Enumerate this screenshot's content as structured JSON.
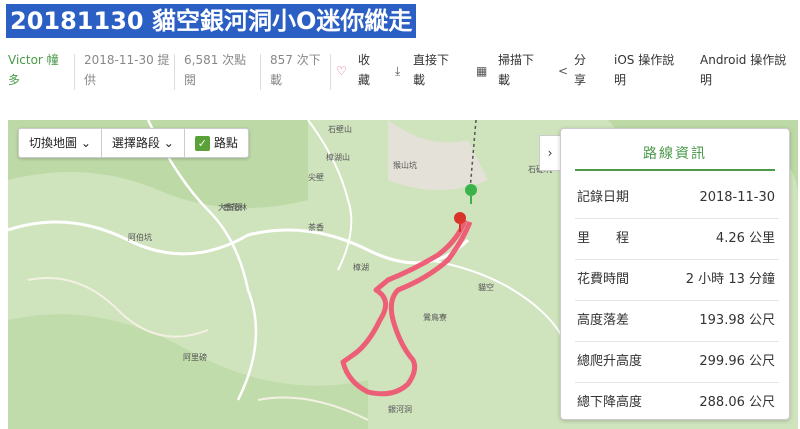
{
  "title": "20181130 貓空銀河洞小O迷你縱走",
  "meta": {
    "author_line1": "Victor 幢",
    "author_line2": "多",
    "date_line1": "2018-11-30 提",
    "date_line2": "供",
    "views_line1": "6,581 次點",
    "views_line2": "閱",
    "downloads_line1": "857 次下",
    "downloads_line2": "載",
    "fav_line1": "收",
    "fav_line2": "藏",
    "direct_line1": "直接下",
    "direct_line2": "載",
    "scan_line1": "掃描下",
    "scan_line2": "載",
    "share_line1": "分",
    "share_line2": "享",
    "ios_line1": "iOS 操作說",
    "ios_line2": "明",
    "android_line1": "Android 操作說",
    "android_line2": "明"
  },
  "toolbar": {
    "switch_map": "切換地圖",
    "select_route": "選擇路段",
    "waypoints": "路點"
  },
  "map_labels": [
    "石壁山",
    "樟湖山",
    "猴山坑",
    "尖壁",
    "大崙頭",
    "阿伯坑",
    "香花林",
    "茶香",
    "樟湖",
    "貓空",
    "鶯鳥寮",
    "阿里磅",
    "銀河洞",
    "石碇坑"
  ],
  "panel": {
    "title": "路線資訊",
    "rows": [
      {
        "label": "記錄日期",
        "value": "2018-11-30"
      },
      {
        "label": "里　　程",
        "value": "4.26 公里"
      },
      {
        "label": "花費時間",
        "value": "2 小時 13 分鐘"
      },
      {
        "label": "高度落差",
        "value": "193.98 公尺"
      },
      {
        "label": "總爬升高度",
        "value": "299.96 公尺"
      },
      {
        "label": "總下降高度",
        "value": "288.06 公尺"
      }
    ]
  },
  "colors": {
    "accent": "#4a9a4a",
    "route": "#f0506e",
    "title_bg": "#2b5fc4"
  }
}
